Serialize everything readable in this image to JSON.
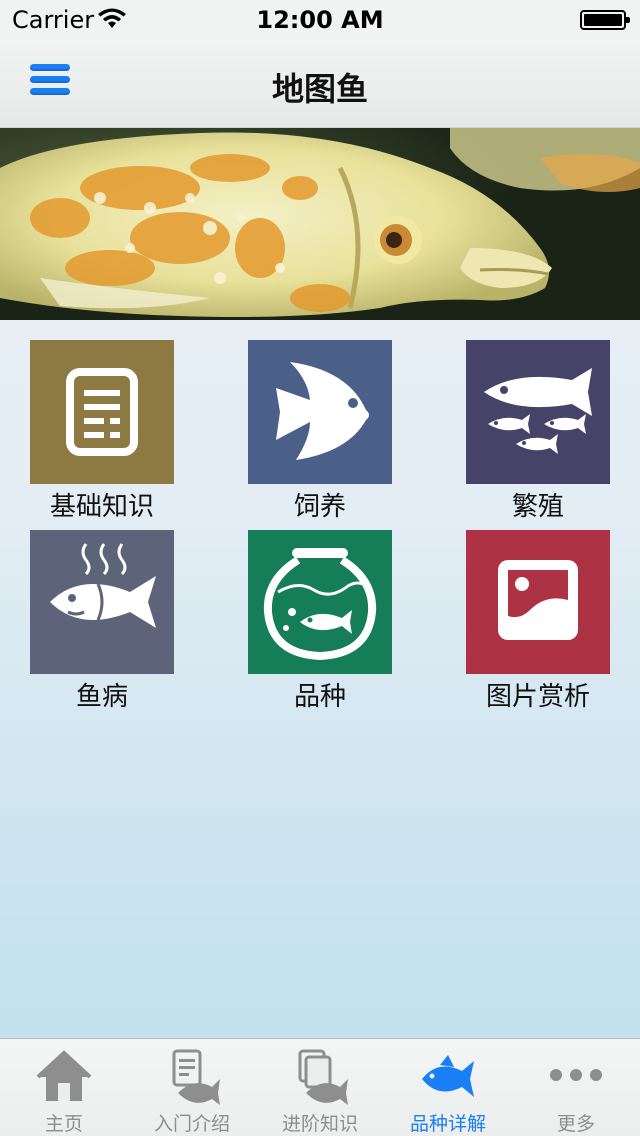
{
  "status_bar": {
    "carrier": "Carrier",
    "time": "12:00 AM"
  },
  "nav": {
    "title": "地图鱼",
    "menu_icon": "hamburger-menu-icon"
  },
  "banner": {
    "image": "oscar-fish-photo"
  },
  "tiles": [
    {
      "label": "基础知识",
      "icon": "document-list-icon",
      "color": "#8d7a42"
    },
    {
      "label": "饲养",
      "icon": "angelfish-icon",
      "color": "#4a6088"
    },
    {
      "label": "繁殖",
      "icon": "fish-school-icon",
      "color": "#454468"
    },
    {
      "label": "鱼病",
      "icon": "sick-fish-icon",
      "color": "#5d647a"
    },
    {
      "label": "品种",
      "icon": "fishbowl-icon",
      "color": "#157e58"
    },
    {
      "label": "图片赏析",
      "icon": "picture-icon",
      "color": "#ad3344"
    }
  ],
  "tabs": [
    {
      "label": "主页",
      "icon": "home-icon",
      "active": false
    },
    {
      "label": "入门介绍",
      "icon": "intro-doc-fish-icon",
      "active": false
    },
    {
      "label": "进阶知识",
      "icon": "advanced-knowledge-fish-icon",
      "active": false
    },
    {
      "label": "品种详解",
      "icon": "fish-icon",
      "active": true
    },
    {
      "label": "更多",
      "icon": "more-dots-icon",
      "active": false
    }
  ],
  "colors": {
    "accent": "#1a7ef5",
    "tab_inactive": "#8e8e8e"
  }
}
